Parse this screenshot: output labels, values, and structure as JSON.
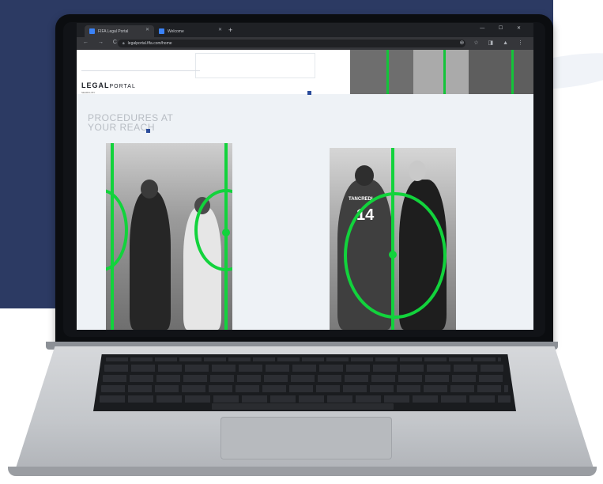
{
  "browser": {
    "tabs": [
      {
        "label": "FIFA Legal Portal",
        "active": true
      },
      {
        "label": "Welcome",
        "active": false
      }
    ],
    "new_tab_label": "+",
    "window_controls": "— ☐ ✕",
    "url": "legalportal.fifa.com/home",
    "nav_icons": "← → C ⌂",
    "toolbar_icons": "⊕ ☆ ◨ ▲ ⋮"
  },
  "page": {
    "logo_main": "LEGAL",
    "logo_sub_word": "PORTAL",
    "logo_caption": "SEARCH BY",
    "headline_line1": "PROCEDURES AT",
    "headline_line2": "YOUR REACH"
  },
  "photo2": {
    "jersey_name": "TANCREDI",
    "jersey_number": "14"
  },
  "colors": {
    "background_navy": "#2c3a63",
    "accent_green": "#12d33c",
    "accent_blue": "#2b4c9b"
  }
}
